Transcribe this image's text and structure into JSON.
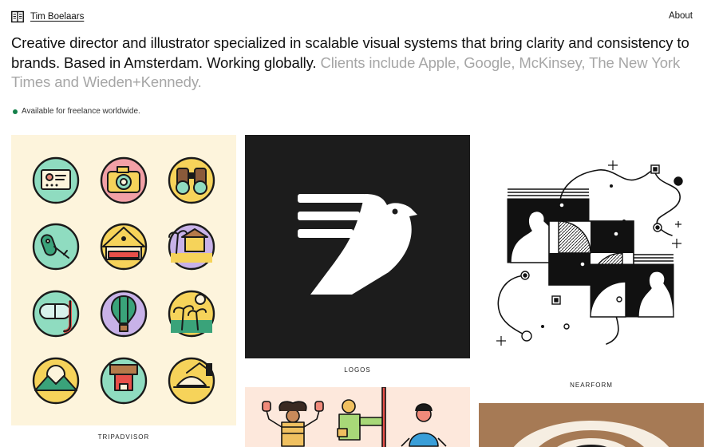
{
  "header": {
    "name": "Tim Boelaars",
    "about_label": "About"
  },
  "intro": {
    "lead": "Creative director and illustrator specialized in scalable visual systems that bring clarity and consistency to brands. Based in Amsterdam. Working globally.",
    "clients": "Clients include Apple, Google, McKinsey, The New York Times and Wieden+Kennedy."
  },
  "availability": {
    "text": "Available for freelance worldwide.",
    "status_color": "#14804a"
  },
  "projects": [
    {
      "caption": "TRIPADVISOR",
      "background": "#fdf4dc"
    },
    {
      "caption": "LOGOS",
      "background": "#1c1c1c"
    },
    {
      "caption": "NEARFORM",
      "background": "#ffffff"
    },
    {
      "caption": "",
      "background": "#fde8dc"
    },
    {
      "caption": "",
      "background": "#a67a55"
    }
  ],
  "icons": [
    "book-icon",
    "status-dot-icon"
  ]
}
